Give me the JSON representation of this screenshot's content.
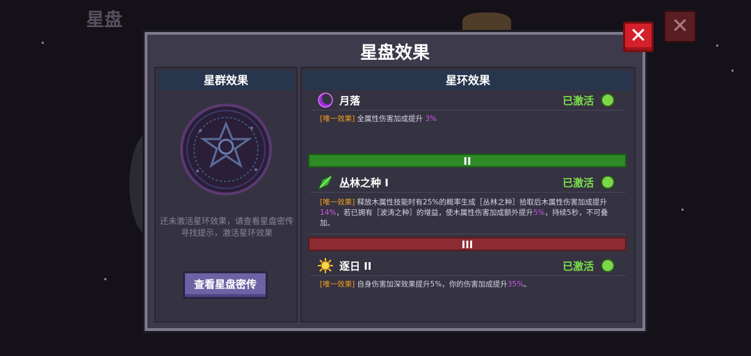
{
  "background": {
    "title": "星盘"
  },
  "modal": {
    "title": "星盘效果",
    "close_icon": "close-icon",
    "left_panel": {
      "header": "星群效果",
      "hint": "还未激活星环效果，请查看星盘密传寻找提示，激活星环效果",
      "button_label": "查看星盘密传"
    },
    "right_panel": {
      "header": "星环效果",
      "effects": [
        {
          "name": "月落",
          "icon": "crescent-moon-icon",
          "status": "已激活",
          "tag": "[唯一效果]",
          "desc": [
            {
              "text": " 全属性伤害加成提升 "
            },
            {
              "text": "3%",
              "hl": true
            }
          ]
        },
        {
          "name": "丛林之种 I",
          "icon": "leaf-gem-icon",
          "status": "已激活",
          "tag": "[唯一效果]",
          "desc": [
            {
              "text": " 释放木属性技能时有25%的概率生成［丛林之种］拾取后木属性伤害加成提升"
            },
            {
              "text": "14%",
              "hl": true
            },
            {
              "text": "，若已拥有［波涛之种］的增益，使木属性伤害加成额外提升"
            },
            {
              "text": "5%",
              "hl": true
            },
            {
              "text": "，持续5秒，不可叠加。"
            }
          ]
        },
        {
          "name": "逐日 II",
          "icon": "sun-icon",
          "status": "已激活",
          "tag": "[唯一效果]",
          "desc": [
            {
              "text": " 自身伤害加深效果提升5%，你的伤害加成提升"
            },
            {
              "text": "35%",
              "hl": true
            },
            {
              "text": "。"
            }
          ]
        }
      ],
      "tiers": [
        "II",
        "III"
      ]
    }
  },
  "colors": {
    "status_active": "#7be04a",
    "tag": "#f0a020",
    "highlight": "#c85ae6",
    "tier_green": "#2d8a26",
    "tier_red": "#8c2b32"
  }
}
